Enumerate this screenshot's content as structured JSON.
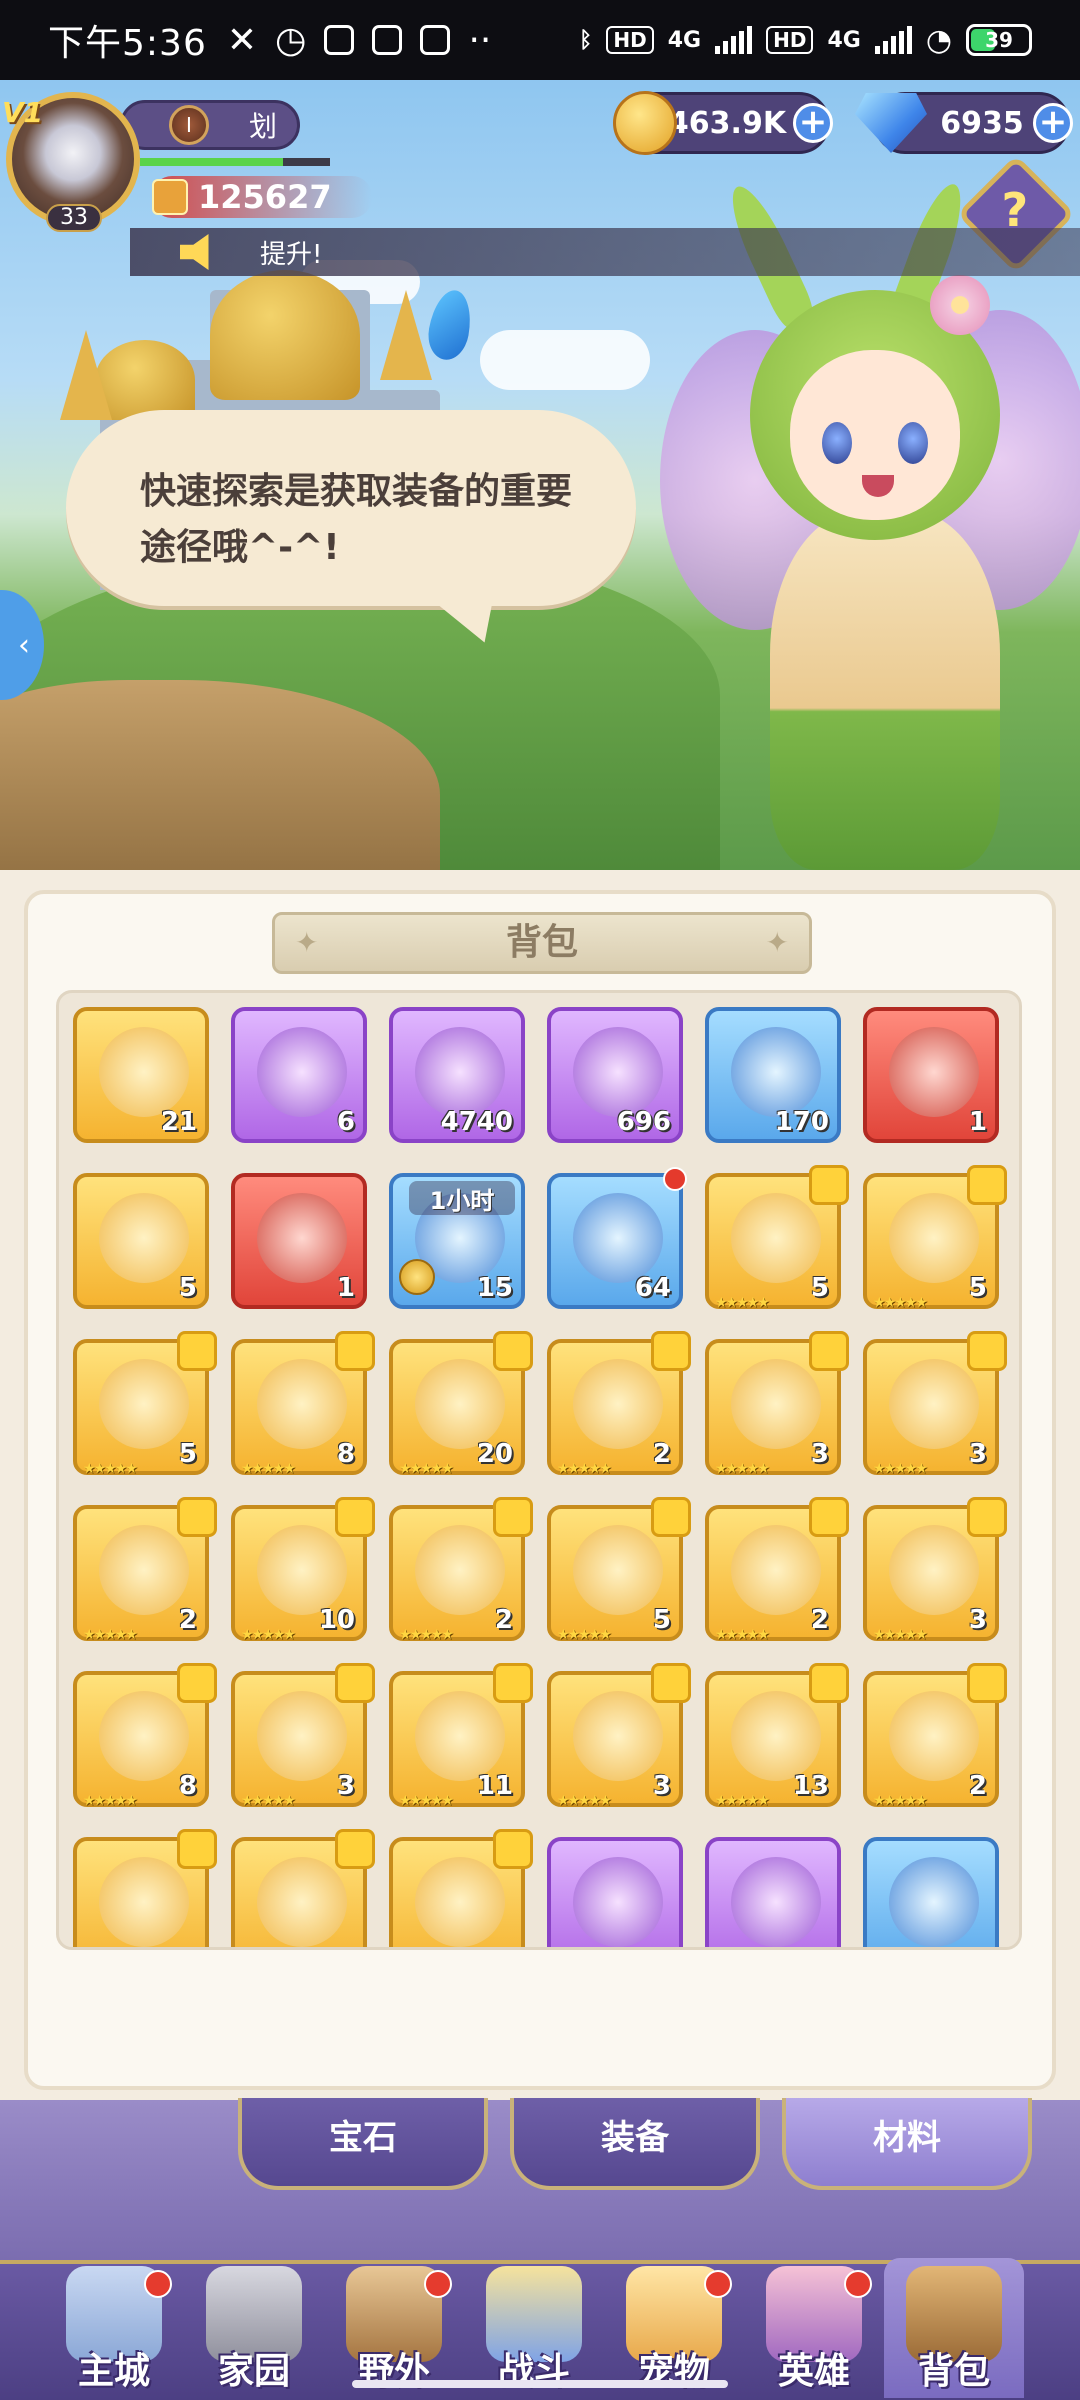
{
  "status_bar": {
    "time": "下午5:36",
    "hd1": "HD",
    "net1": "4G",
    "hd2": "HD",
    "net2": "4G",
    "battery": "39"
  },
  "hud": {
    "vip": "V1",
    "level": "33",
    "name_tag": "I",
    "player_name": "划",
    "power": "125627",
    "gold": "463.9K",
    "diamonds": "6935",
    "help": "?",
    "notice": "提升!"
  },
  "speech": {
    "text": "快速探索是获取装备的重要途径哦^-^!"
  },
  "bag": {
    "title": "背包",
    "items": [
      {
        "count": "21",
        "quality": "gold",
        "icon": "crystal-item-icon"
      },
      {
        "count": "6",
        "quality": "purple",
        "icon": "scroll-icon"
      },
      {
        "count": "4740",
        "quality": "purple",
        "icon": "stone-icon"
      },
      {
        "count": "696",
        "quality": "purple",
        "icon": "paw-stone-icon"
      },
      {
        "count": "170",
        "quality": "blue",
        "icon": "bread-icon"
      },
      {
        "count": "1",
        "quality": "red",
        "icon": "mystery-bag-icon"
      },
      {
        "count": "5",
        "quality": "gold",
        "icon": "scroll-roll-icon"
      },
      {
        "count": "1",
        "quality": "red",
        "icon": "book-icon"
      },
      {
        "count": "15",
        "quality": "blue",
        "icon": "timed-chest-icon",
        "timer": "1小时"
      },
      {
        "count": "64",
        "quality": "blue",
        "icon": "hero-card-icon"
      },
      {
        "count": "5",
        "quality": "gold",
        "icon": "hero-shard-icon"
      },
      {
        "count": "5",
        "quality": "gold",
        "icon": "hero-shard-icon"
      },
      {
        "count": "5",
        "quality": "gold",
        "icon": "hero-shard-icon"
      },
      {
        "count": "8",
        "quality": "gold",
        "icon": "hero-shard-icon"
      },
      {
        "count": "20",
        "quality": "gold",
        "icon": "hero-shard-icon"
      },
      {
        "count": "2",
        "quality": "gold",
        "icon": "hero-shard-icon"
      },
      {
        "count": "3",
        "quality": "gold",
        "icon": "hero-shard-icon"
      },
      {
        "count": "3",
        "quality": "gold",
        "icon": "hero-shard-icon"
      },
      {
        "count": "2",
        "quality": "gold",
        "icon": "hero-shard-icon"
      },
      {
        "count": "10",
        "quality": "gold",
        "icon": "hero-shard-icon"
      },
      {
        "count": "2",
        "quality": "gold",
        "icon": "hero-shard-icon"
      },
      {
        "count": "5",
        "quality": "gold",
        "icon": "hero-shard-icon"
      },
      {
        "count": "2",
        "quality": "gold",
        "icon": "hero-shard-icon"
      },
      {
        "count": "3",
        "quality": "gold",
        "icon": "hero-shard-icon"
      },
      {
        "count": "8",
        "quality": "gold",
        "icon": "hero-shard-icon"
      },
      {
        "count": "3",
        "quality": "gold",
        "icon": "hero-shard-icon"
      },
      {
        "count": "11",
        "quality": "gold",
        "icon": "hero-shard-icon"
      },
      {
        "count": "3",
        "quality": "gold",
        "icon": "hero-shard-icon"
      },
      {
        "count": "13",
        "quality": "gold",
        "icon": "hero-shard-icon"
      },
      {
        "count": "2",
        "quality": "gold",
        "icon": "hero-shard-icon"
      },
      {
        "count": "",
        "quality": "gold",
        "icon": "hero-shard-icon"
      },
      {
        "count": "",
        "quality": "gold",
        "icon": "hero-shard-icon"
      },
      {
        "count": "",
        "quality": "gold",
        "icon": "hero-shard-icon"
      },
      {
        "count": "",
        "quality": "purple",
        "icon": "pink-crystal-icon"
      },
      {
        "count": "",
        "quality": "purple",
        "icon": "emblem-icon"
      },
      {
        "count": "",
        "quality": "blue",
        "icon": "potion-icon"
      }
    ]
  },
  "tabs": [
    {
      "label": "宝石"
    },
    {
      "label": "装备"
    },
    {
      "label": "材料"
    }
  ],
  "nav": [
    {
      "label": "主城",
      "icon": "castle-icon"
    },
    {
      "label": "家园",
      "icon": "home-icon"
    },
    {
      "label": "野外",
      "icon": "wild-icon"
    },
    {
      "label": "战斗",
      "icon": "sword-icon"
    },
    {
      "label": "宠物",
      "icon": "pet-icon"
    },
    {
      "label": "英雄",
      "icon": "hero-icon"
    },
    {
      "label": "背包",
      "icon": "bag-icon"
    }
  ],
  "colors": {
    "accent": "#6e5aa8",
    "gold": "#f5b330",
    "panel": "#f3ece0"
  }
}
